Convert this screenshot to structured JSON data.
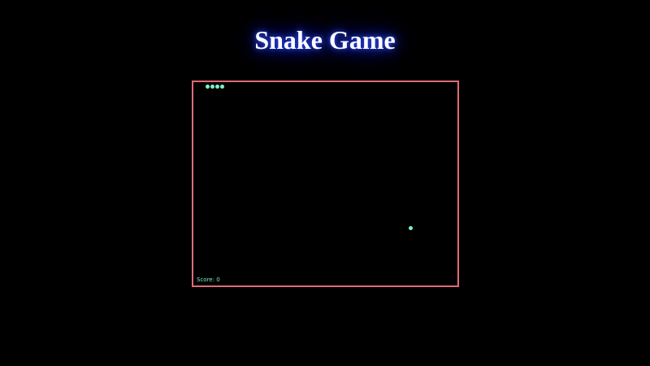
{
  "app": {
    "title": "Snake Game"
  },
  "game": {
    "score_text": "Score: 0",
    "score": 0,
    "snake_length": 4,
    "colors": {
      "background": "#000000",
      "border": "#e06b77",
      "snake": "#7ff0c8",
      "food": "#7ff0c8",
      "score": "#7ff0c8",
      "title_glow": "#2f4cff"
    }
  }
}
